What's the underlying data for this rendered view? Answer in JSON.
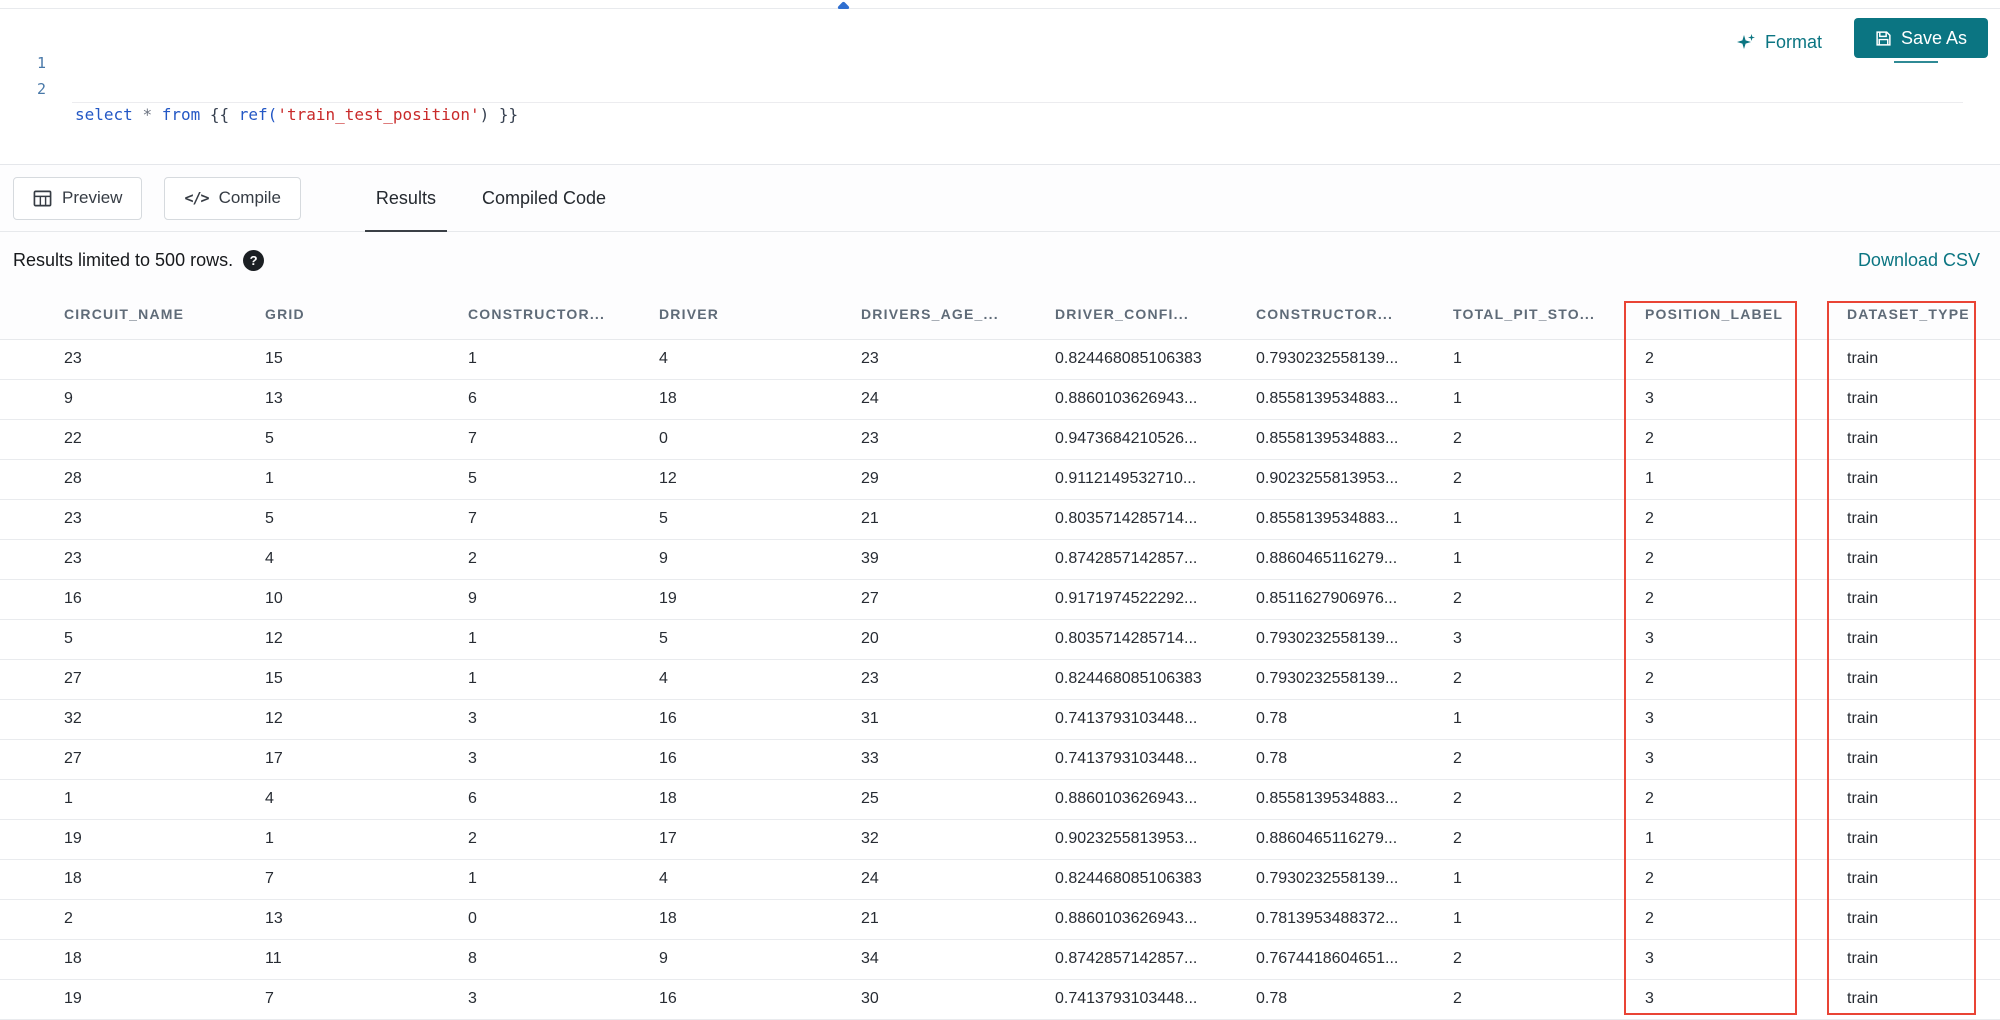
{
  "editor": {
    "line_numbers": [
      "1",
      "2"
    ],
    "code_tokens": [
      {
        "text": "select",
        "type": "keyword"
      },
      {
        "text": " ",
        "type": "plain"
      },
      {
        "text": "*",
        "type": "operator"
      },
      {
        "text": " ",
        "type": "plain"
      },
      {
        "text": "from",
        "type": "keyword"
      },
      {
        "text": " {{ ",
        "type": "plain"
      },
      {
        "text": "ref(",
        "type": "function"
      },
      {
        "text": "'train_test_position'",
        "type": "string"
      },
      {
        "text": ") }}",
        "type": "plain"
      }
    ]
  },
  "header_actions": {
    "format_label": "Format",
    "save_as_label": "Save As"
  },
  "toolbar": {
    "preview_label": "Preview",
    "compile_label": "Compile",
    "tabs": [
      {
        "label": "Results",
        "active": true
      },
      {
        "label": "Compiled Code",
        "active": false
      }
    ]
  },
  "results_bar": {
    "limit_text": "Results limited to 500 rows.",
    "help_icon": "?",
    "download_link": "Download CSV"
  },
  "table": {
    "columns": [
      "CIRCUIT_NAME",
      "GRID",
      "CONSTRUCTOR...",
      "DRIVER",
      "DRIVERS_AGE_...",
      "DRIVER_CONFI...",
      "CONSTRUCTOR...",
      "TOTAL_PIT_STO...",
      "POSITION_LABEL",
      "DATASET_TYPE"
    ],
    "highlighted_columns": [
      "POSITION_LABEL",
      "DATASET_TYPE"
    ],
    "rows": [
      [
        "23",
        "15",
        "1",
        "4",
        "23",
        "0.824468085106383",
        "0.7930232558139...",
        "1",
        "2",
        "train"
      ],
      [
        "9",
        "13",
        "6",
        "18",
        "24",
        "0.8860103626943...",
        "0.8558139534883...",
        "1",
        "3",
        "train"
      ],
      [
        "22",
        "5",
        "7",
        "0",
        "23",
        "0.9473684210526...",
        "0.8558139534883...",
        "2",
        "2",
        "train"
      ],
      [
        "28",
        "1",
        "5",
        "12",
        "29",
        "0.9112149532710...",
        "0.9023255813953...",
        "2",
        "1",
        "train"
      ],
      [
        "23",
        "5",
        "7",
        "5",
        "21",
        "0.8035714285714...",
        "0.8558139534883...",
        "1",
        "2",
        "train"
      ],
      [
        "23",
        "4",
        "2",
        "9",
        "39",
        "0.8742857142857...",
        "0.8860465116279...",
        "1",
        "2",
        "train"
      ],
      [
        "16",
        "10",
        "9",
        "19",
        "27",
        "0.9171974522292...",
        "0.8511627906976...",
        "2",
        "2",
        "train"
      ],
      [
        "5",
        "12",
        "1",
        "5",
        "20",
        "0.8035714285714...",
        "0.7930232558139...",
        "3",
        "3",
        "train"
      ],
      [
        "27",
        "15",
        "1",
        "4",
        "23",
        "0.824468085106383",
        "0.7930232558139...",
        "2",
        "2",
        "train"
      ],
      [
        "32",
        "12",
        "3",
        "16",
        "31",
        "0.7413793103448...",
        "0.78",
        "1",
        "3",
        "train"
      ],
      [
        "27",
        "17",
        "3",
        "16",
        "33",
        "0.7413793103448...",
        "0.78",
        "2",
        "3",
        "train"
      ],
      [
        "1",
        "4",
        "6",
        "18",
        "25",
        "0.8860103626943...",
        "0.8558139534883...",
        "2",
        "2",
        "train"
      ],
      [
        "19",
        "1",
        "2",
        "17",
        "32",
        "0.9023255813953...",
        "0.8860465116279...",
        "2",
        "1",
        "train"
      ],
      [
        "18",
        "7",
        "1",
        "4",
        "24",
        "0.824468085106383",
        "0.7930232558139...",
        "1",
        "2",
        "train"
      ],
      [
        "2",
        "13",
        "0",
        "18",
        "21",
        "0.8860103626943...",
        "0.7813953488372...",
        "1",
        "2",
        "train"
      ],
      [
        "18",
        "11",
        "8",
        "9",
        "34",
        "0.8742857142857...",
        "0.7674418604651...",
        "2",
        "3",
        "train"
      ],
      [
        "19",
        "7",
        "3",
        "16",
        "30",
        "0.7413793103448...",
        "0.78",
        "2",
        "3",
        "train"
      ]
    ]
  },
  "colors": {
    "accent_teal": "#0b7582",
    "highlight_red": "#e94435",
    "keyword_blue": "#2458c5",
    "string_red": "#c92a2a"
  }
}
